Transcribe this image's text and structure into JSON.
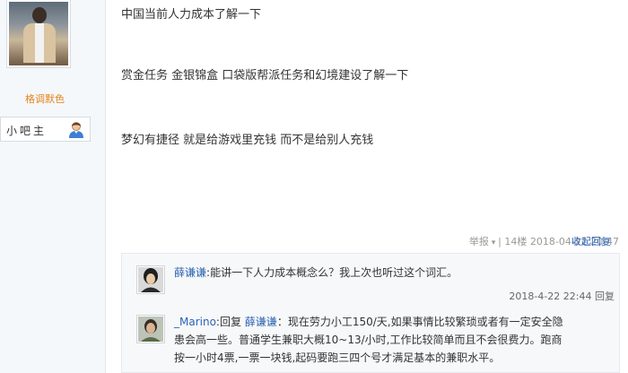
{
  "sidebar": {
    "username": "格调默色",
    "rank_label": "小吧主"
  },
  "post": {
    "lines": [
      "中国当前人力成本了解一下",
      "赏金任务 金银锦盒 口袋版帮派任务和幻境建设了解一下",
      "梦幻有捷径 就是给游戏里充钱 而不是给别人充钱"
    ],
    "report": "举报",
    "floor": "14楼",
    "time": "2018-04-22 20:47",
    "collapse_label": "收起回复"
  },
  "replies": [
    {
      "user": "薛谦谦",
      "colon": ":",
      "text": "能讲一下人力成本概念么？我上次也听过这个词汇。",
      "time": "2018-4-22 22:44",
      "reply_label": "回复"
    },
    {
      "user": "_Marino",
      "colon": ":",
      "prefix": "回复 ",
      "target": "薛谦谦",
      "lines": [
        "：现在劳力小工150/天,如果事情比较繁琐或者有一定安全隐",
        "患会高一些。普通学生兼职大概10~13/小时,工作比较简单而且不会很费力。跑商",
        "按一小时4票,一票一块钱,起码要跑三四个号才满足基本的兼职水平。"
      ]
    }
  ]
}
